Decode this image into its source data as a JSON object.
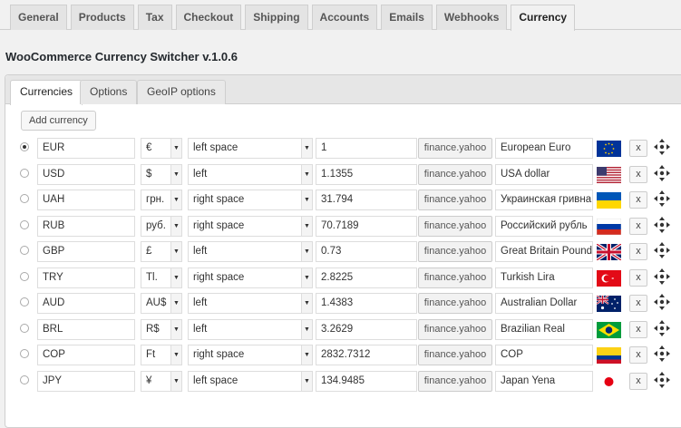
{
  "nav_tabs": [
    {
      "label": "General"
    },
    {
      "label": "Products"
    },
    {
      "label": "Tax"
    },
    {
      "label": "Checkout"
    },
    {
      "label": "Shipping"
    },
    {
      "label": "Accounts"
    },
    {
      "label": "Emails"
    },
    {
      "label": "Webhooks"
    },
    {
      "label": "Currency",
      "active": true
    }
  ],
  "page_title": "WooCommerce Currency Switcher v.1.0.6",
  "sub_tabs": [
    {
      "label": "Currencies",
      "active": true
    },
    {
      "label": "Options"
    },
    {
      "label": "GeoIP options"
    }
  ],
  "add_button": "Add currency",
  "rate_source_label": "finance.yahoo",
  "delete_label": "x",
  "currencies": [
    {
      "code": "EUR",
      "symbol": "€",
      "position": "left space",
      "rate": "1",
      "description": "European Euro",
      "flag": "eu-flag",
      "selected": true
    },
    {
      "code": "USD",
      "symbol": "$",
      "position": "left",
      "rate": "1.1355",
      "description": "USA dollar",
      "flag": "us-flag",
      "selected": false
    },
    {
      "code": "UAH",
      "symbol": "грн.",
      "position": "right space",
      "rate": "31.794",
      "description": "Украинская гривна",
      "flag": "ua-flag",
      "selected": false
    },
    {
      "code": "RUB",
      "symbol": "руб.",
      "position": "right space",
      "rate": "70.7189",
      "description": "Российский рубль",
      "flag": "ru-flag",
      "selected": false
    },
    {
      "code": "GBP",
      "symbol": "£",
      "position": "left",
      "rate": "0.73",
      "description": "Great Britain Pound",
      "flag": "gb-flag",
      "selected": false
    },
    {
      "code": "TRY",
      "symbol": "Tl.",
      "position": "right space",
      "rate": "2.8225",
      "description": "Turkish Lira",
      "flag": "tr-flag",
      "selected": false
    },
    {
      "code": "AUD",
      "symbol": "AU$",
      "position": "left",
      "rate": "1.4383",
      "description": "Australian Dollar",
      "flag": "au-flag",
      "selected": false
    },
    {
      "code": "BRL",
      "symbol": "R$",
      "position": "left",
      "rate": "3.2629",
      "description": "Brazilian Real",
      "flag": "br-flag",
      "selected": false
    },
    {
      "code": "COP",
      "symbol": "Ft",
      "position": "right space",
      "rate": "2832.7312",
      "description": "COP",
      "flag": "co-flag",
      "selected": false
    },
    {
      "code": "JPY",
      "symbol": "¥",
      "position": "left space",
      "rate": "134.9485",
      "description": "Japan Yena",
      "flag": "jp-flag",
      "selected": false
    }
  ]
}
